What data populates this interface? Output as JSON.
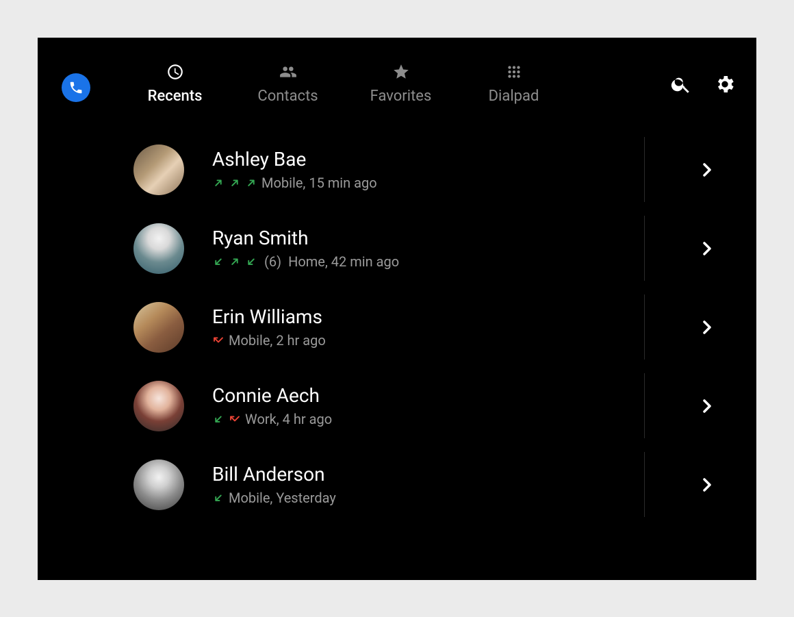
{
  "tabs": [
    {
      "label": "Recents",
      "icon": "clock",
      "active": true
    },
    {
      "label": "Contacts",
      "icon": "people",
      "active": false
    },
    {
      "label": "Favorites",
      "icon": "star",
      "active": false
    },
    {
      "label": "Dialpad",
      "icon": "dialpad",
      "active": false
    }
  ],
  "actions": {
    "search_label": "Search",
    "settings_label": "Settings"
  },
  "calls": [
    {
      "name": "Ashley Bae",
      "arrows": [
        "out",
        "out",
        "out"
      ],
      "count": "",
      "detail": "Mobile, 15 min ago",
      "avatar": {
        "bg": "linear-gradient(135deg,#6b5a46 0%, #b49a76 40%, #e6d0b5 60%, #8c7255 100%)"
      }
    },
    {
      "name": "Ryan Smith",
      "arrows": [
        "in",
        "out",
        "in"
      ],
      "count": "(6)",
      "detail": "Home, 42 min ago",
      "avatar": {
        "bg": "radial-gradient(circle at 50% 30%, #f2f2f2 0%, #d9d9d9 25%, #6b8a8f 55%, #305b69 100%)"
      }
    },
    {
      "name": "Erin Williams",
      "arrows": [
        "missed"
      ],
      "count": "",
      "detail": "Mobile, 2 hr ago",
      "avatar": {
        "bg": "linear-gradient(140deg,#d8c7a0 0%, #b58a5a 35%, #8a5d40 60%, #5c3b29 100%)"
      }
    },
    {
      "name": "Connie Aech",
      "arrows": [
        "in",
        "missed"
      ],
      "count": "",
      "detail": "Work, 4 hr ago",
      "avatar": {
        "bg": "radial-gradient(circle at 50% 35%, #f6e4dc 0%, #e1b29b 28%, #7a4036 55%, #2a2a2a 100%)"
      }
    },
    {
      "name": "Bill Anderson",
      "arrows": [
        "in"
      ],
      "count": "",
      "detail": "Mobile, Yesterday",
      "avatar": {
        "bg": "radial-gradient(circle at 50% 35%, #f2f2f2 0%, #cfcfcf 25%, #8a8a8a 55%, #3a3a3a 100%)"
      }
    }
  ]
}
